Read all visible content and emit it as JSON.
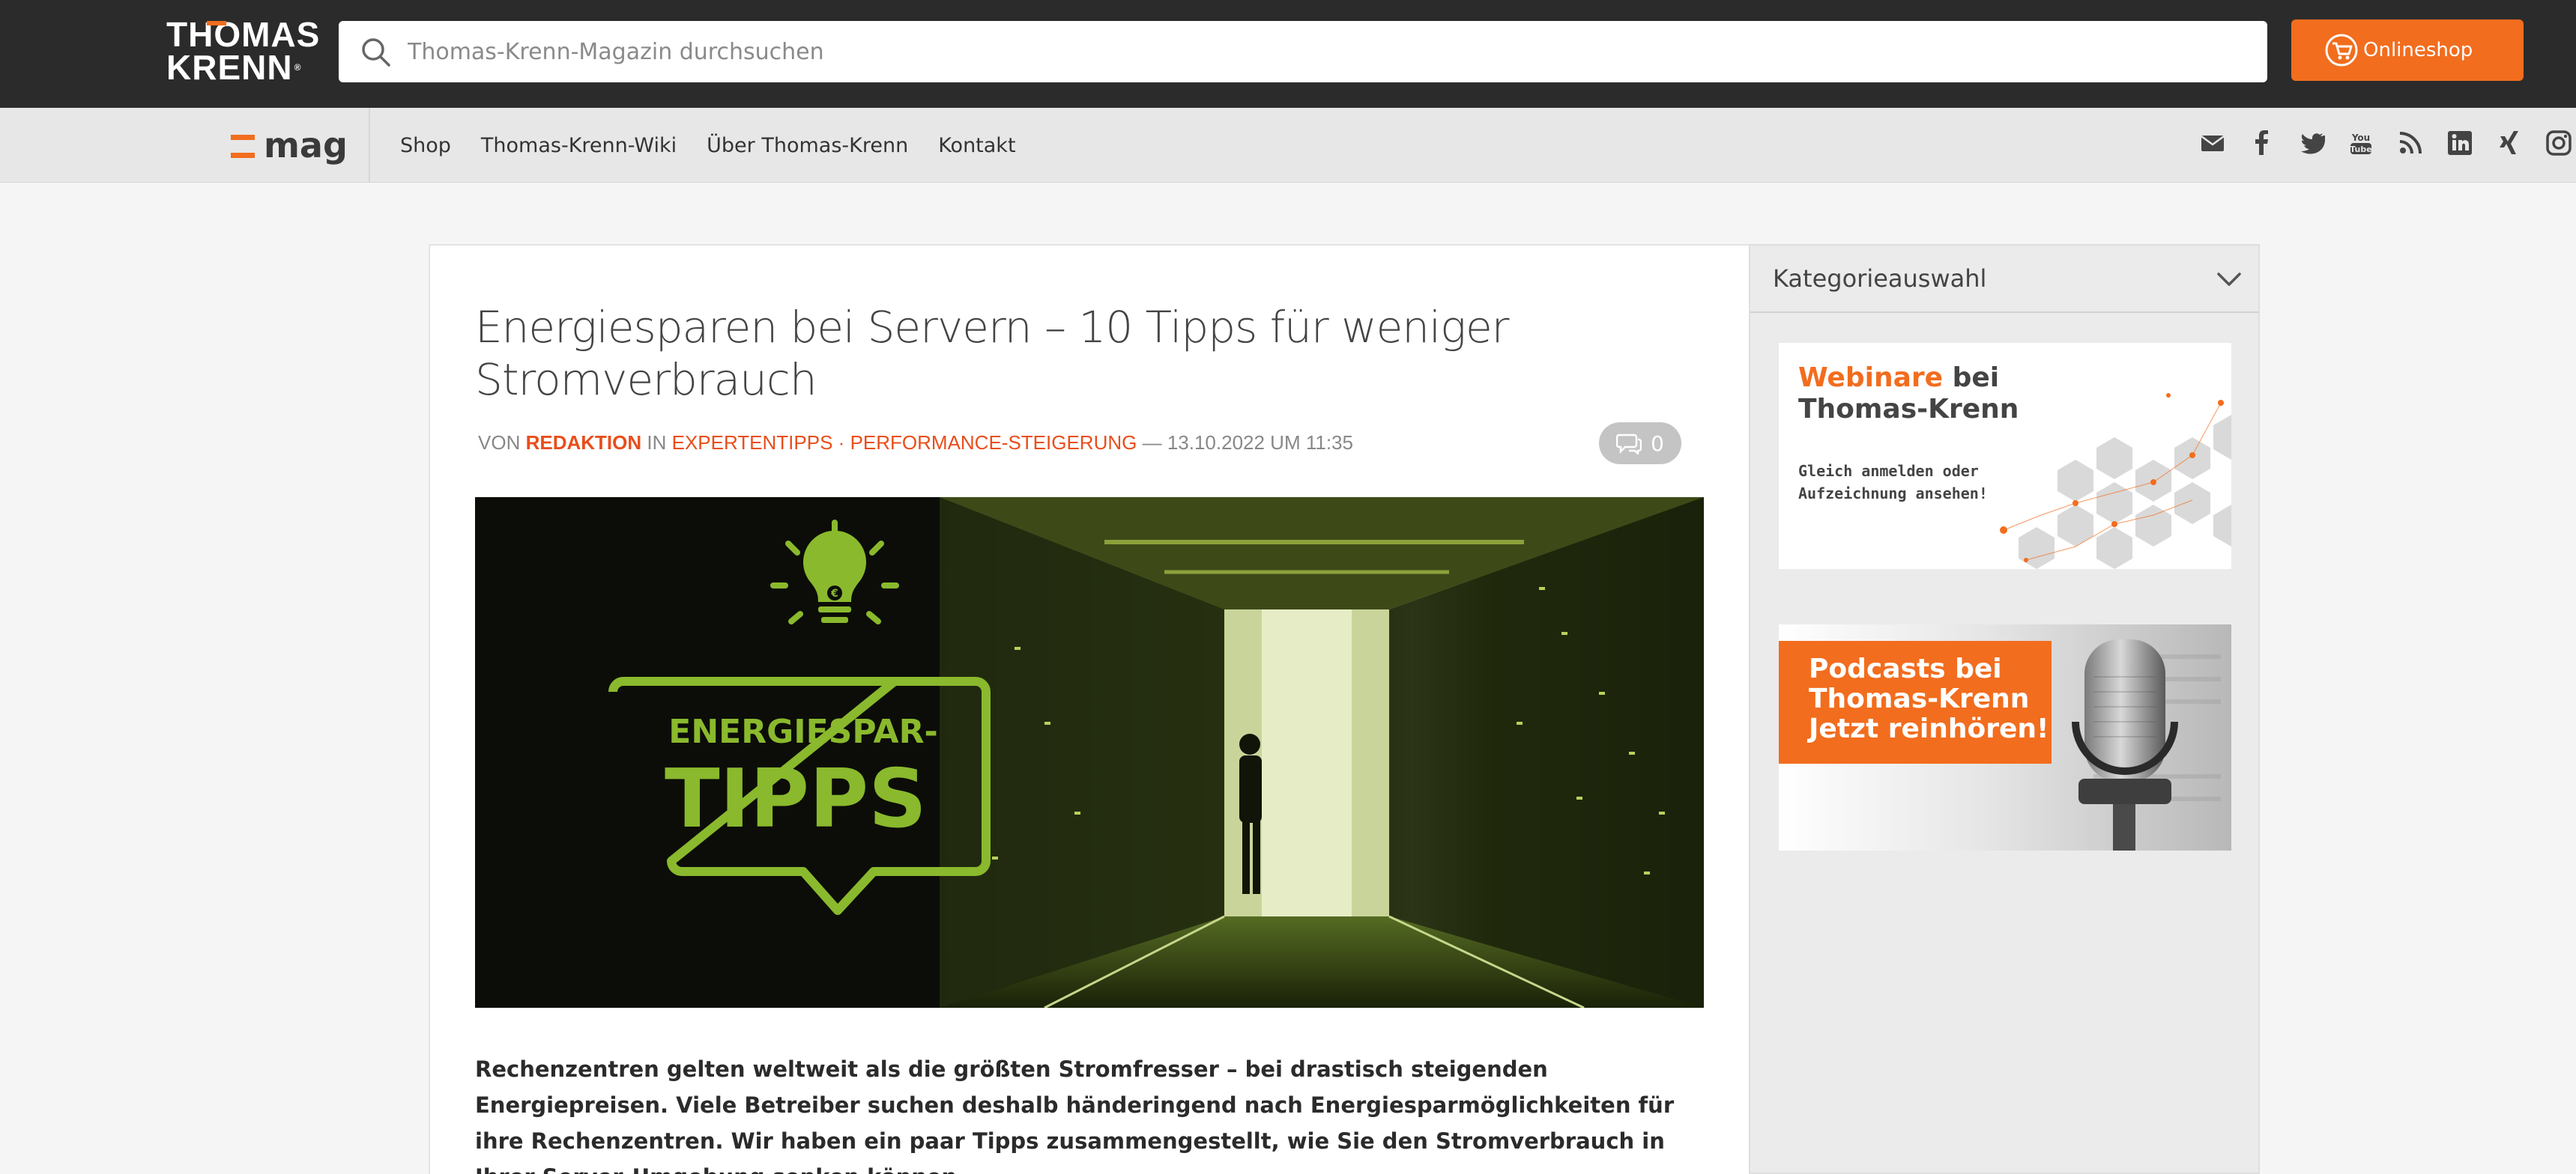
{
  "brand": {
    "logo_line1": "THOMAS",
    "logo_line2": "KRENN",
    "accent_color": "#f26d1e",
    "header_color": "#2b2b2b"
  },
  "search": {
    "placeholder": "Thomas-Krenn-Magazin durchsuchen"
  },
  "header": {
    "shop_button_label": "Onlineshop"
  },
  "nav": {
    "mag_label": "mag",
    "links": [
      {
        "label": "Shop"
      },
      {
        "label": "Thomas-Krenn-Wiki"
      },
      {
        "label": "Über Thomas-Krenn"
      },
      {
        "label": "Kontakt"
      }
    ],
    "social_icons": [
      "mail-icon",
      "facebook-icon",
      "twitter-icon",
      "youtube-icon",
      "rss-icon",
      "linkedin-icon",
      "xing-icon",
      "instagram-icon"
    ]
  },
  "article": {
    "title": "Energiesparen bei Servern – 10 Tipps für weniger Stromverbrauch",
    "meta": {
      "by_label": "VON",
      "author": "REDAKTION",
      "in_label": "IN",
      "category_1": "EXPERTENTIPPS",
      "separator": "·",
      "category_2": "PERFORMANCE-STEIGERUNG",
      "date": "— 13.10.2022 UM 11:35"
    },
    "comment_count": "0",
    "hero": {
      "line1": "ENERGIESPAR-",
      "line2": "TIPPS",
      "accent_color": "#8ab92d"
    },
    "lead": "Rechenzentren gelten weltweit als die größten Stromfresser – bei drastisch steigenden Energiepreisen. Viele Betreiber suchen deshalb händeringend nach Energiesparmöglichkeiten für ihre Rechenzentren. Wir haben ein paar Tipps zusammengestellt, wie Sie den Stromverbrauch in Ihrer Server-Umgebung senken können."
  },
  "sidebar": {
    "category_label": "Kategorieauswahl",
    "ad_webinar": {
      "title_accent": "Webinare",
      "title_rest": " bei",
      "title_line2": "Thomas-Krenn",
      "subtitle": "Gleich anmelden oder Aufzeichnung ansehen!"
    },
    "ad_podcast": {
      "line1": "Podcasts bei",
      "line2": "Thomas-Krenn",
      "line3": "Jetzt reinhören!"
    }
  }
}
